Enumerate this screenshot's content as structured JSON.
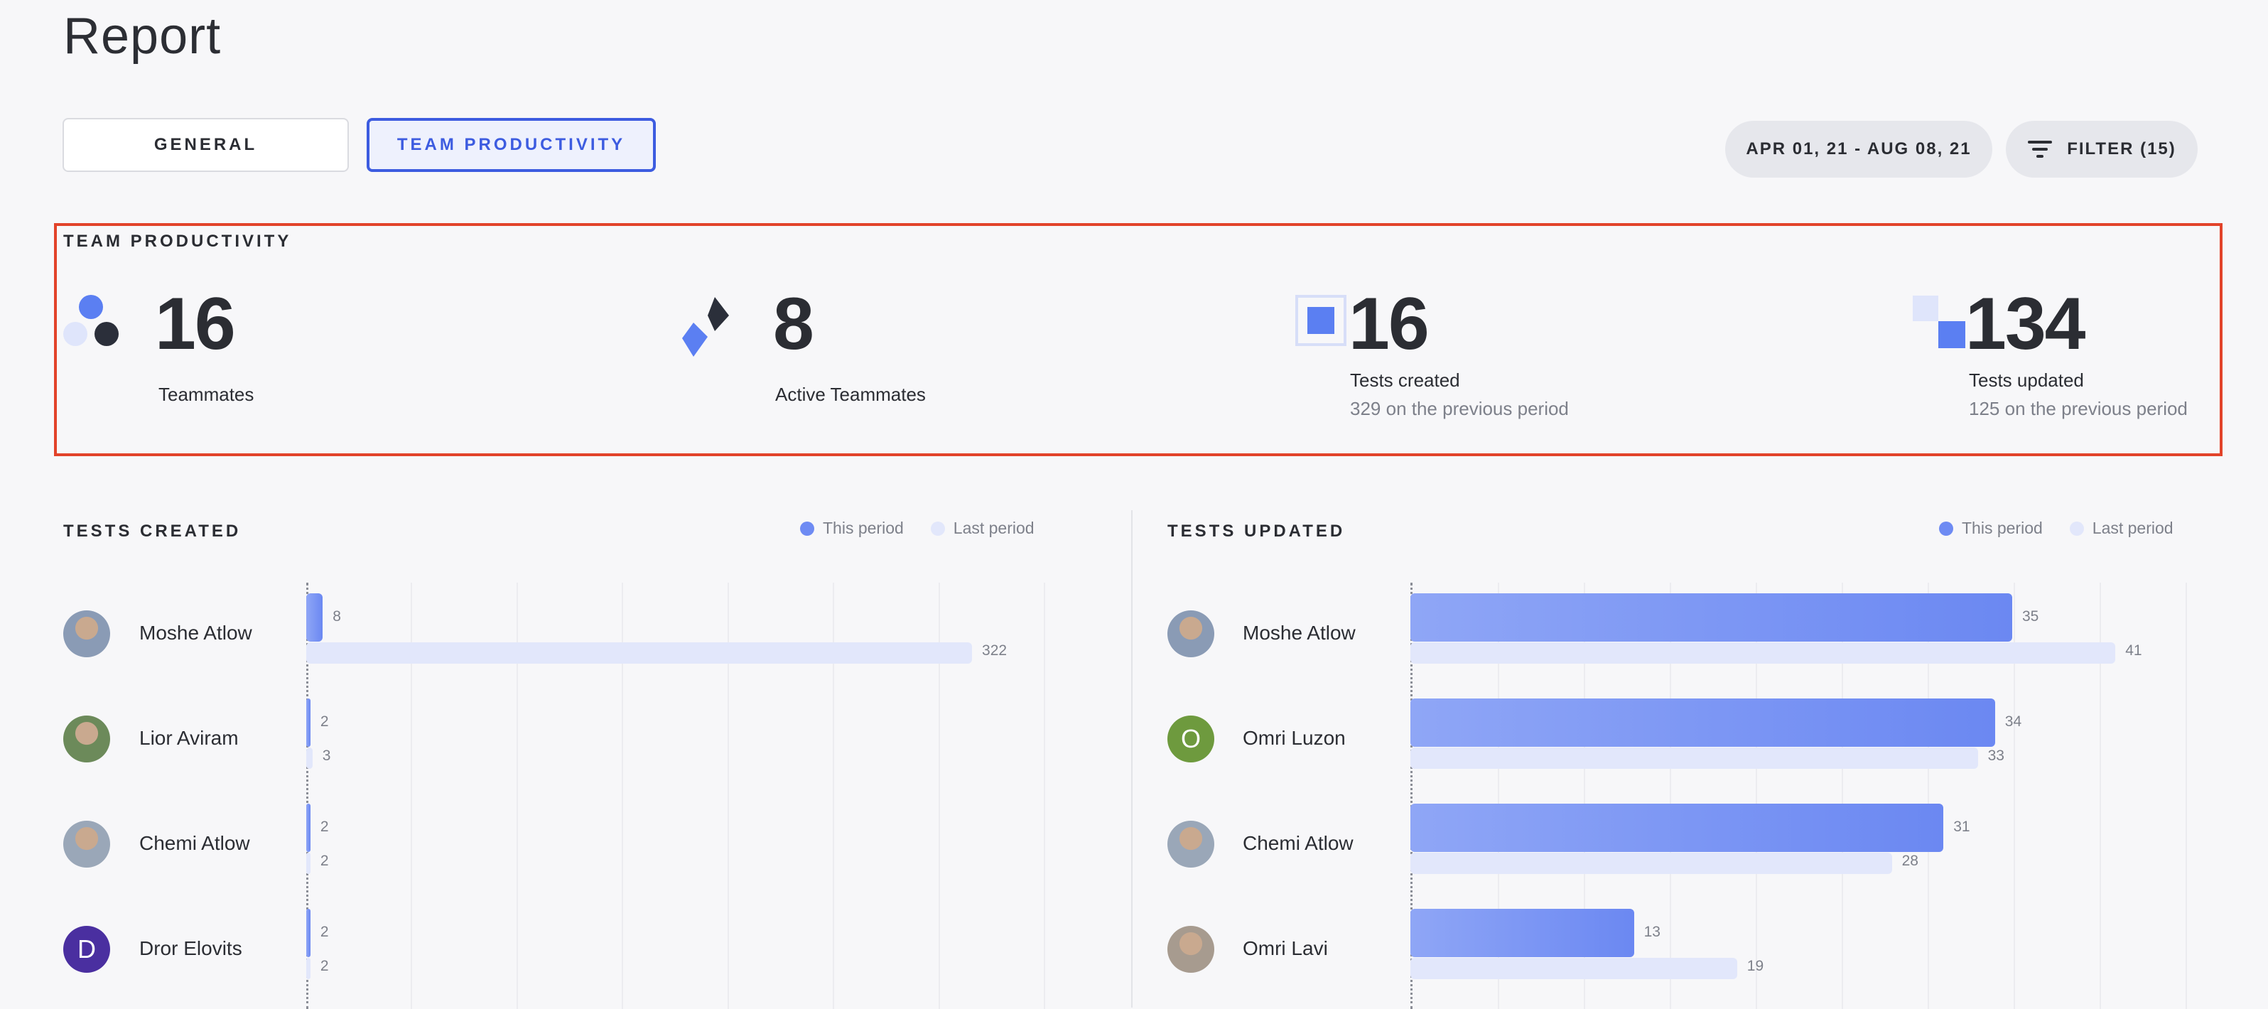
{
  "page": {
    "title": "Report"
  },
  "tabs": {
    "general": "GENERAL",
    "team_productivity": "TEAM PRODUCTIVITY"
  },
  "toolbar": {
    "date_range": "APR 01, 21 - AUG 08, 21",
    "filter_label": "FILTER (15)"
  },
  "summary": {
    "heading": "TEAM PRODUCTIVITY",
    "teammates": {
      "value": "16",
      "label": "Teammates"
    },
    "active": {
      "value": "8",
      "label": "Active Teammates"
    },
    "created": {
      "value": "16",
      "label": "Tests created",
      "previous": "329 on the previous period"
    },
    "updated": {
      "value": "134",
      "label": "Tests updated",
      "previous": "125 on the previous period"
    }
  },
  "legend": {
    "this_period": "This period",
    "last_period": "Last period"
  },
  "colors": {
    "accent": "#3d5ce0",
    "bar_this": "#6e8bf3",
    "bar_last": "#e2e7fb",
    "highlight_border": "#e2432a"
  },
  "tests_created": {
    "title": "TESTS CREATED",
    "rows": [
      {
        "name": "Moshe Atlow",
        "this": 8,
        "last": 322
      },
      {
        "name": "Lior Aviram",
        "this": 2,
        "last": 3
      },
      {
        "name": "Chemi Atlow",
        "this": 2,
        "last": 2
      },
      {
        "name": "Dror Elovits",
        "initial": "D",
        "this": 2,
        "last": 2
      }
    ]
  },
  "tests_updated": {
    "title": "TESTS UPDATED",
    "rows": [
      {
        "name": "Moshe Atlow",
        "this": 35,
        "last": 41
      },
      {
        "name": "Omri Luzon",
        "initial": "O",
        "this": 34,
        "last": 33
      },
      {
        "name": "Chemi Atlow",
        "this": 31,
        "last": 28
      },
      {
        "name": "Omri Lavi",
        "this": 13,
        "last": 19
      }
    ]
  },
  "chart_data": [
    {
      "type": "bar",
      "title": "TESTS CREATED",
      "categories": [
        "Moshe Atlow",
        "Lior Aviram",
        "Chemi Atlow",
        "Dror Elovits"
      ],
      "series": [
        {
          "name": "This period",
          "values": [
            8,
            2,
            2,
            2
          ]
        },
        {
          "name": "Last period",
          "values": [
            322,
            3,
            2,
            2
          ]
        }
      ]
    },
    {
      "type": "bar",
      "title": "TESTS UPDATED",
      "categories": [
        "Moshe Atlow",
        "Omri Luzon",
        "Chemi Atlow",
        "Omri Lavi"
      ],
      "series": [
        {
          "name": "This period",
          "values": [
            35,
            34,
            31,
            13
          ]
        },
        {
          "name": "Last period",
          "values": [
            41,
            33,
            28,
            19
          ]
        }
      ]
    }
  ]
}
